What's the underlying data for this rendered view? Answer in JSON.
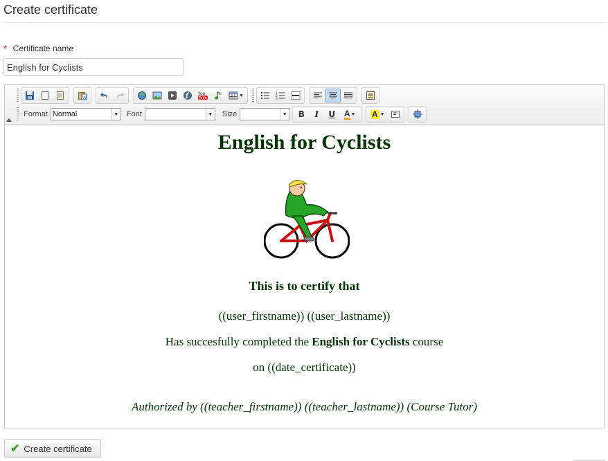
{
  "page": {
    "title": "Create certificate"
  },
  "form": {
    "required_marker": "*",
    "name_label": "Certificate name",
    "name_value": "English for Cyclists",
    "submit_label": "Create certificate"
  },
  "toolbar": {
    "format_label": "Format",
    "format_value": "Normal",
    "font_label": "Font",
    "font_value": "",
    "size_label": "Size",
    "size_value": "",
    "bold": "B",
    "italic": "I",
    "underline": "U",
    "text_color": "A",
    "bg_color": "A",
    "icons": [
      "save-icon",
      "new-page-icon",
      "templates-icon",
      "paste-word-icon",
      "undo-icon",
      "redo-icon",
      "image-manager-icon",
      "image-icon",
      "video-icon",
      "flash-icon",
      "youtube-icon",
      "audio-icon",
      "table-icon",
      "bulleted-list-icon",
      "numbered-list-icon",
      "horizontal-rule-icon",
      "align-left-icon",
      "align-center-icon",
      "justify-icon",
      "show-blocks-icon",
      "remove-format-icon",
      "maximize-icon"
    ]
  },
  "certificate": {
    "heading": "English for Cyclists",
    "certify_line": "This is to certify that",
    "name_line": "((user_firstname)) ((user_lastname))",
    "completed_prefix": "Has succesfully completed the ",
    "completed_course": "English for Cyclists",
    "completed_suffix": " course",
    "date_line": "on ((date_certificate))",
    "authorized_line": "Authorized by ((teacher_firstname)) ((teacher_lastname)) (Course Tutor)"
  },
  "colors": {
    "certificate_text": "#003300",
    "required": "#cc0000",
    "check": "#3c9b2e"
  }
}
